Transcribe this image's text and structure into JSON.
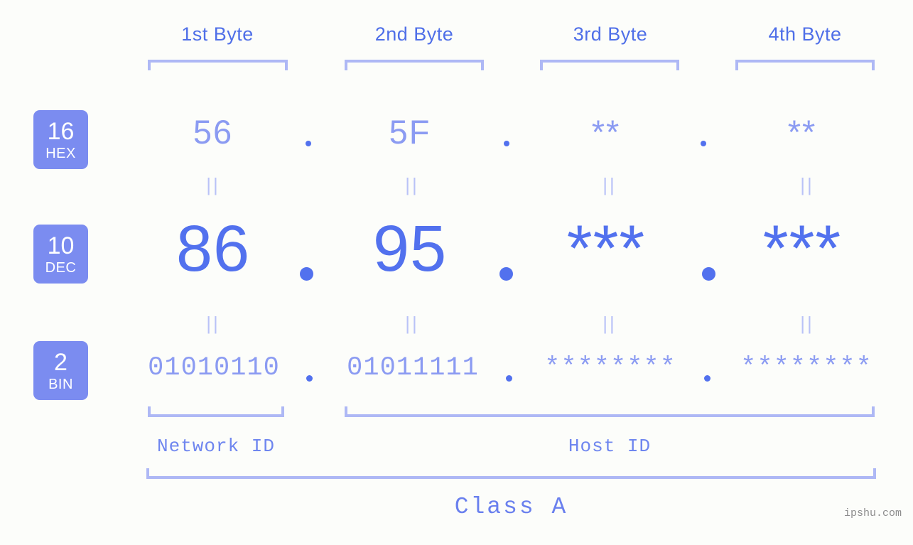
{
  "site": {
    "watermark": "ipshu.com"
  },
  "byte_headers": [
    {
      "label": "1st Byte"
    },
    {
      "label": "2nd Byte"
    },
    {
      "label": "3rd Byte"
    },
    {
      "label": "4th Byte"
    }
  ],
  "radix_badges": [
    {
      "number": "16",
      "name": "HEX"
    },
    {
      "number": "10",
      "name": "DEC"
    },
    {
      "number": "2",
      "name": "BIN"
    }
  ],
  "rows": {
    "hex": {
      "values": [
        "56",
        "5F",
        "**",
        "**"
      ]
    },
    "dec": {
      "values": [
        "86",
        "95",
        "***",
        "***"
      ]
    },
    "bin": {
      "values": [
        "01010110",
        "01011111",
        "********",
        "********"
      ]
    }
  },
  "separators": {
    "symbol": "."
  },
  "equals_marks": {
    "symbol": "||"
  },
  "segments": {
    "network_id": "Network ID",
    "host_id": "Host ID",
    "class": "Class A"
  },
  "colors": {
    "background": "#fcfdfa",
    "accent_strong": "#5271ee",
    "accent_mid": "#8b9bf2",
    "accent_light": "#aeb8f5",
    "badge_bg": "#7b8cf0",
    "header_text": "#4f6fe8",
    "watermark_text": "#8d8d8d"
  }
}
